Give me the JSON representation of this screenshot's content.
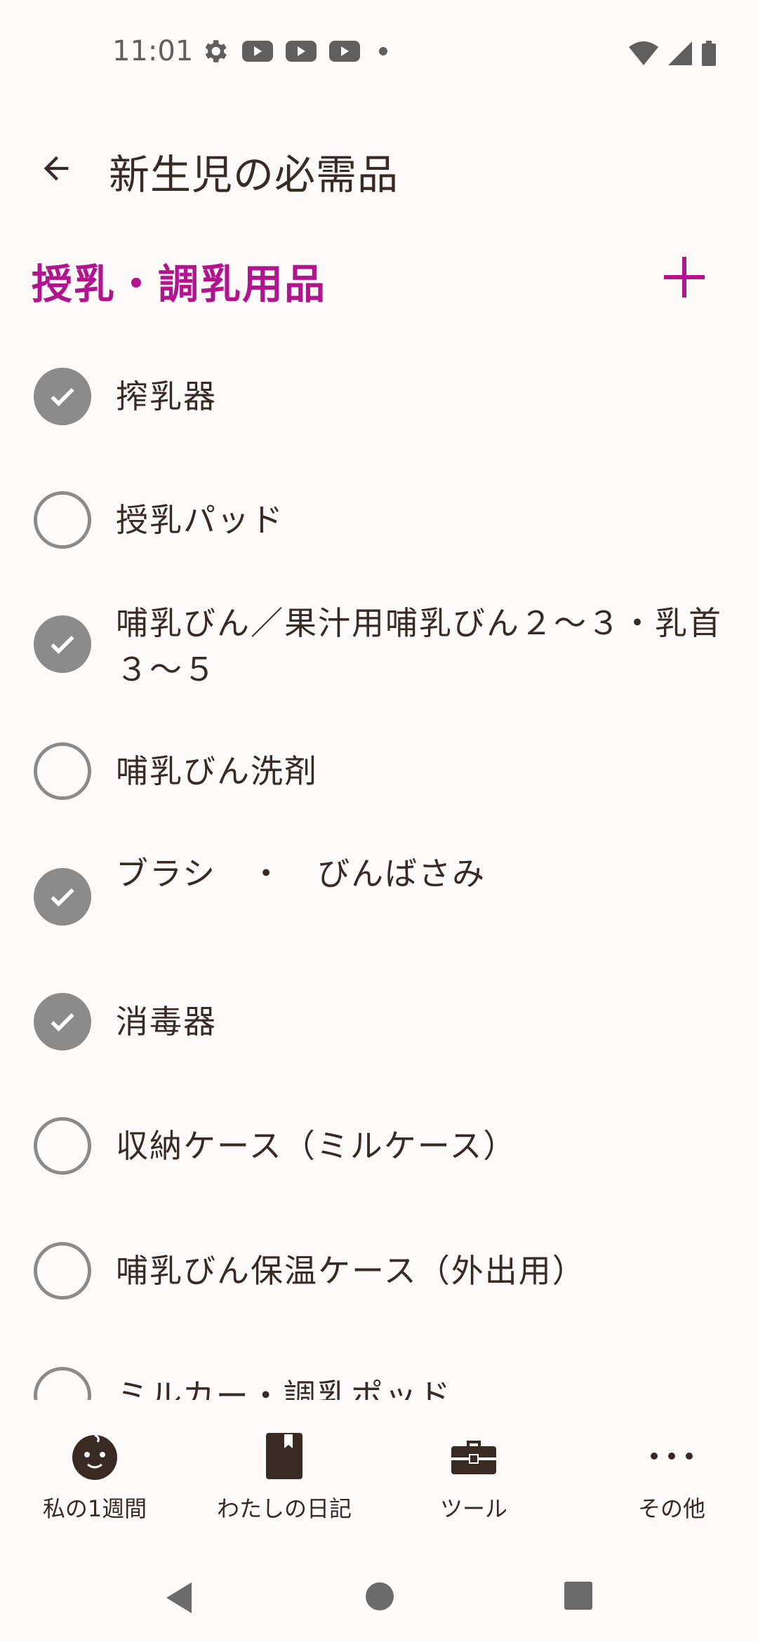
{
  "status_bar": {
    "time": "11:01"
  },
  "header": {
    "title": "新生児の必需品"
  },
  "section": {
    "title": "授乳・調乳用品"
  },
  "items": [
    {
      "label": "搾乳器",
      "checked": true
    },
    {
      "label": "授乳パッド",
      "checked": false
    },
    {
      "label": "哺乳びん／果汁用哺乳びん２〜３・乳首３〜５",
      "checked": true
    },
    {
      "label": "哺乳びん洗剤",
      "checked": false
    },
    {
      "label": "ブラシ　・　びんばさみ",
      "checked": true
    },
    {
      "label": "消毒器",
      "checked": true
    },
    {
      "label": "収納ケース（ミルケース）",
      "checked": false
    },
    {
      "label": "哺乳びん保温ケース（外出用）",
      "checked": false
    },
    {
      "label": "ミルカー・調乳ポッド",
      "checked": false
    }
  ],
  "bottom_nav": [
    {
      "label": "私の1週間",
      "icon": "baby-face-icon"
    },
    {
      "label": "わたしの日記",
      "icon": "diary-book-icon"
    },
    {
      "label": "ツール",
      "icon": "toolbox-icon"
    },
    {
      "label": "その他",
      "icon": "more-dots-icon"
    }
  ],
  "colors": {
    "accent": "#b0148f",
    "text": "#3a2a24",
    "check": "#8b8b8b",
    "background": "#fdfafa"
  }
}
